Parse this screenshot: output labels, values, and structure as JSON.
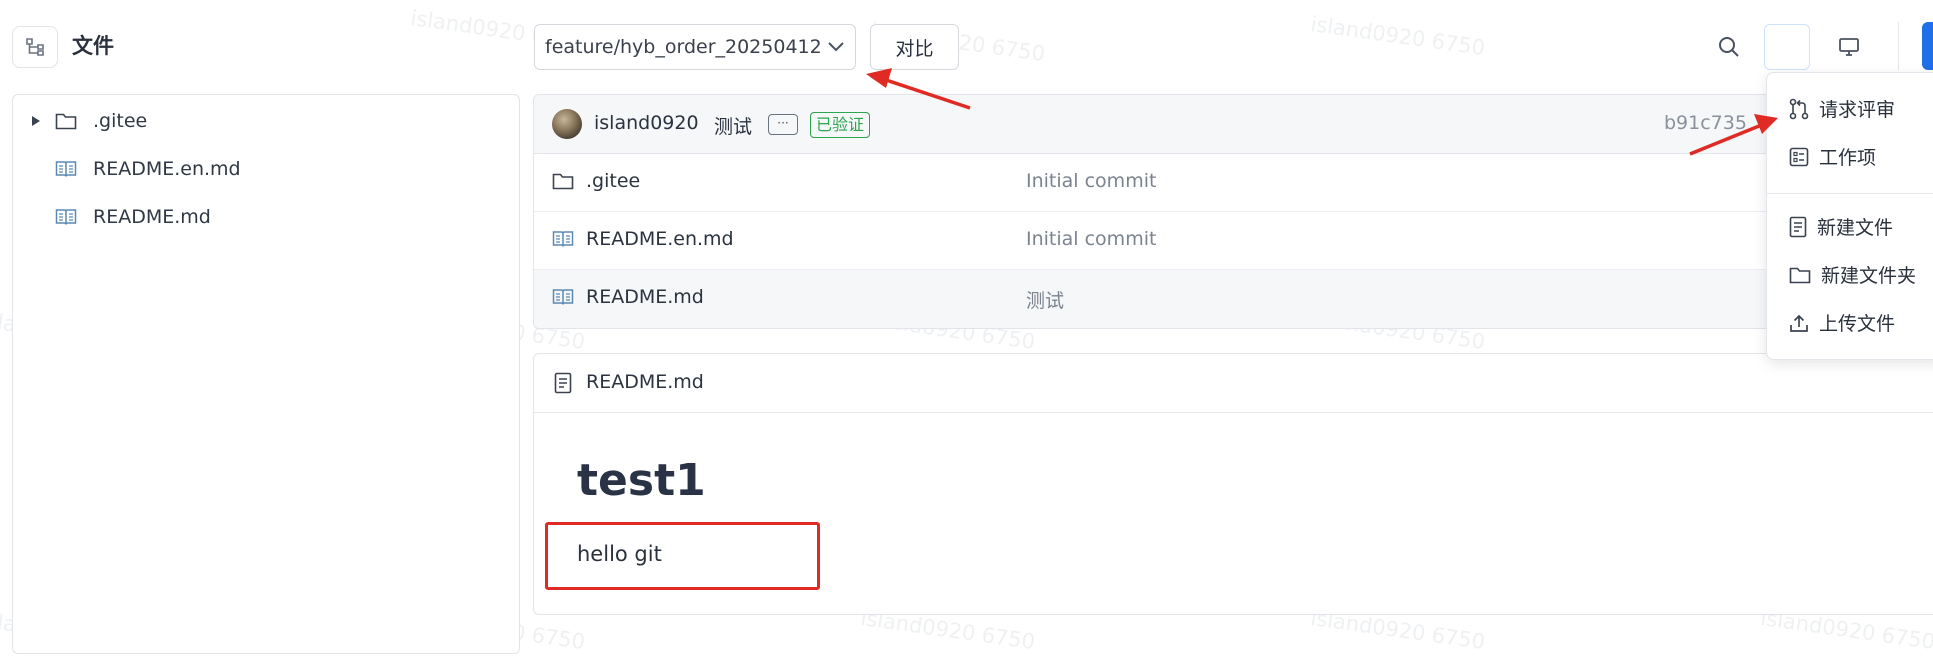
{
  "header": {
    "files_title": "文件",
    "branch": "feature/hyb_order_20250412",
    "compare_label": "对比"
  },
  "tree": [
    {
      "name": ".gitee",
      "type": "folder"
    },
    {
      "name": "README.en.md",
      "type": "file"
    },
    {
      "name": "README.md",
      "type": "file"
    }
  ],
  "commit": {
    "author": "island0920",
    "message": "测试",
    "more": "···",
    "verified": "已验证",
    "hash": "b91c735"
  },
  "files": [
    {
      "name": ".gitee",
      "type": "folder",
      "message": "Initial commit"
    },
    {
      "name": "README.en.md",
      "type": "file",
      "message": "Initial commit"
    },
    {
      "name": "README.md",
      "type": "file",
      "message": "测试"
    }
  ],
  "readme": {
    "filename": "README.md",
    "heading": "test1",
    "paragraph": "hello git"
  },
  "menu": {
    "items": [
      {
        "label": "请求评审",
        "icon": "merge-request-icon"
      },
      {
        "label": "工作项",
        "icon": "task-list-icon"
      },
      {
        "label": "新建文件",
        "icon": "new-file-icon"
      },
      {
        "label": "新建文件夹",
        "icon": "new-folder-icon"
      },
      {
        "label": "上传文件",
        "icon": "upload-icon"
      }
    ]
  },
  "watermark": "island0920 6750",
  "colors": {
    "accent": "#1e6fe8",
    "verified_green": "#2da44e",
    "annotation_red": "#e02a24"
  }
}
